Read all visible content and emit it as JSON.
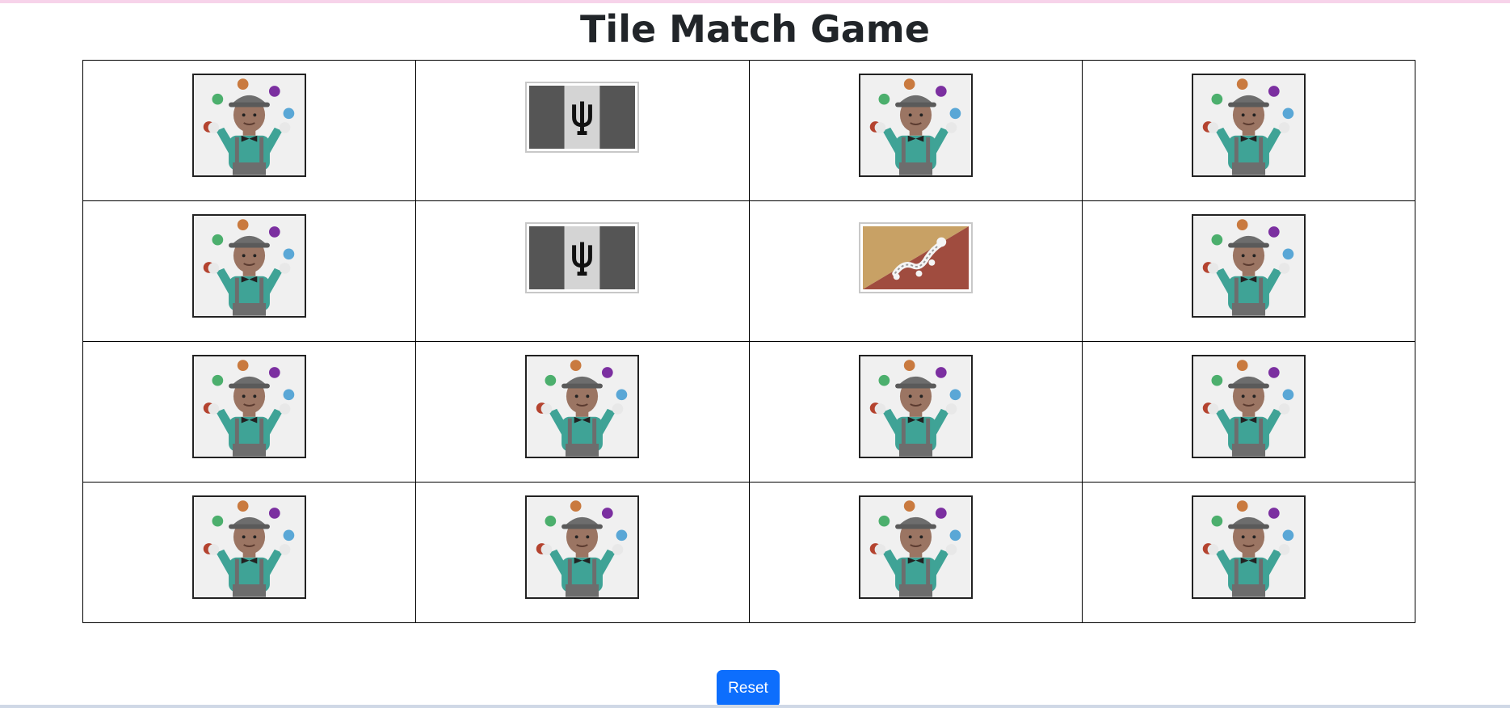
{
  "page": {
    "title": "Tile Match Game"
  },
  "board": {
    "rows": 4,
    "cols": 4,
    "tiles": [
      {
        "icon": "juggler-icon"
      },
      {
        "icon": "barbados-flag-icon"
      },
      {
        "icon": "juggler-icon"
      },
      {
        "icon": "juggler-icon"
      },
      {
        "icon": "juggler-icon"
      },
      {
        "icon": "barbados-flag-icon"
      },
      {
        "icon": "bhutan-flag-icon"
      },
      {
        "icon": "juggler-icon"
      },
      {
        "icon": "juggler-icon"
      },
      {
        "icon": "juggler-icon"
      },
      {
        "icon": "juggler-icon"
      },
      {
        "icon": "juggler-icon"
      },
      {
        "icon": "juggler-icon"
      },
      {
        "icon": "juggler-icon"
      },
      {
        "icon": "juggler-icon"
      },
      {
        "icon": "juggler-icon"
      }
    ]
  },
  "controls": {
    "reset_label": "Reset"
  },
  "colors": {
    "accent": "#0d6efd",
    "top_bar": "#f7d3ea",
    "tile_background": "#f0f0f0",
    "cell_border": "#000000"
  }
}
